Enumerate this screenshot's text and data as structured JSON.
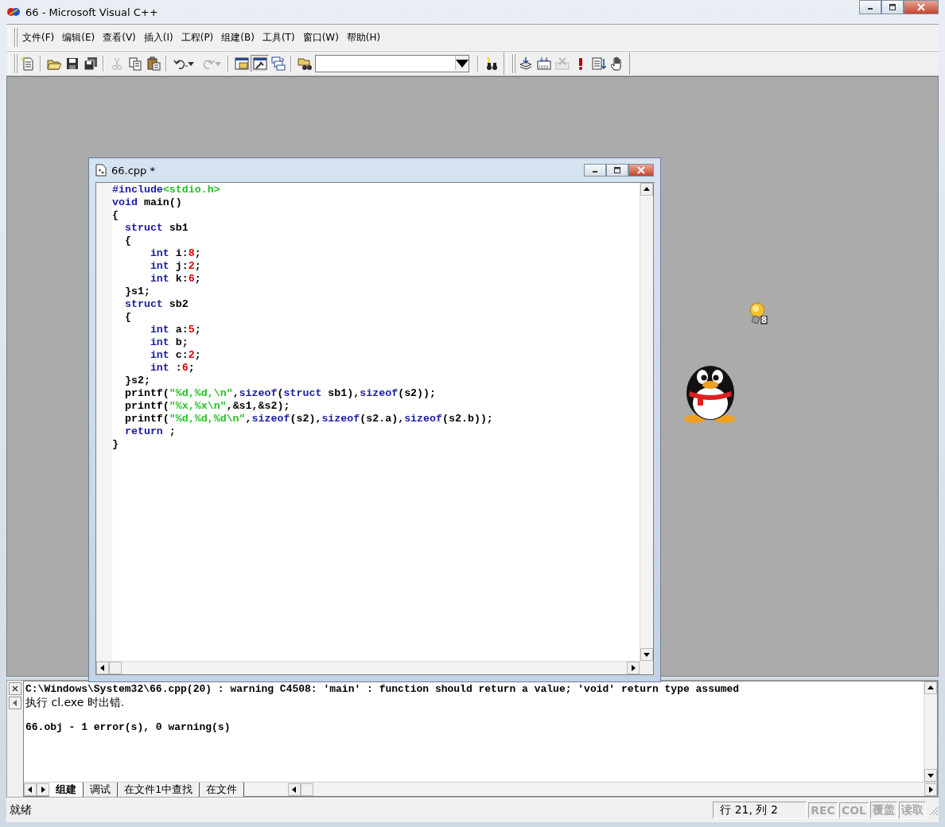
{
  "window": {
    "title": "66 - Microsoft Visual C++"
  },
  "menu": [
    "文件(F)",
    "编辑(E)",
    "查看(V)",
    "插入(I)",
    "工程(P)",
    "组建(B)",
    "工具(T)",
    "窗口(W)",
    "帮助(H)"
  ],
  "toolbars": [
    {
      "kind": "new",
      "disabled": false,
      "pressed": false
    },
    {
      "kind": "sep"
    },
    {
      "kind": "open",
      "disabled": false,
      "pressed": false
    },
    {
      "kind": "save",
      "disabled": false,
      "pressed": false
    },
    {
      "kind": "saveall",
      "disabled": false,
      "pressed": false
    },
    {
      "kind": "sep"
    },
    {
      "kind": "cut",
      "disabled": true,
      "pressed": false
    },
    {
      "kind": "copy",
      "disabled": false,
      "pressed": false
    },
    {
      "kind": "paste",
      "disabled": false,
      "pressed": false
    },
    {
      "kind": "sep"
    },
    {
      "kind": "undo",
      "disabled": false,
      "pressed": false
    },
    {
      "kind": "redo",
      "disabled": true,
      "pressed": false
    },
    {
      "kind": "sep"
    },
    {
      "kind": "workspace",
      "disabled": false,
      "pressed": false
    },
    {
      "kind": "output",
      "disabled": false,
      "pressed": true
    },
    {
      "kind": "windows",
      "disabled": false,
      "pressed": false
    },
    {
      "kind": "sep"
    },
    {
      "kind": "findfiles",
      "disabled": false,
      "pressed": false
    },
    {
      "kind": "combo"
    },
    {
      "kind": "sep"
    },
    {
      "kind": "search",
      "disabled": false,
      "pressed": false
    },
    {
      "kind": "grip"
    },
    {
      "kind": "compile",
      "disabled": false,
      "pressed": false
    },
    {
      "kind": "build",
      "disabled": false,
      "pressed": false
    },
    {
      "kind": "stop",
      "disabled": true,
      "pressed": false
    },
    {
      "kind": "execute",
      "disabled": false,
      "pressed": false
    },
    {
      "kind": "go",
      "disabled": false,
      "pressed": false
    },
    {
      "kind": "breakpoint",
      "disabled": false,
      "pressed": false
    }
  ],
  "editor": {
    "title": "66.cpp *",
    "lines": [
      [
        {
          "kind": "pre",
          "text": "#include"
        },
        {
          "kind": "str",
          "text": "<stdio.h>"
        }
      ],
      [
        {
          "kind": "kw",
          "text": "void"
        },
        {
          "kind": "txt",
          "text": " main()"
        }
      ],
      [
        {
          "kind": "txt",
          "text": "{"
        }
      ],
      [
        {
          "kind": "kw",
          "text": "  struct"
        },
        {
          "kind": "txt",
          "text": " sb1"
        }
      ],
      [
        {
          "kind": "txt",
          "text": "  {"
        }
      ],
      [
        {
          "kind": "kw",
          "text": "      int"
        },
        {
          "kind": "txt",
          "text": " i:"
        },
        {
          "kind": "num",
          "text": "8"
        },
        {
          "kind": "txt",
          "text": ";"
        }
      ],
      [
        {
          "kind": "kw",
          "text": "      int"
        },
        {
          "kind": "txt",
          "text": " j:"
        },
        {
          "kind": "num",
          "text": "2"
        },
        {
          "kind": "txt",
          "text": ";"
        }
      ],
      [
        {
          "kind": "kw",
          "text": "      int"
        },
        {
          "kind": "txt",
          "text": " k:"
        },
        {
          "kind": "num",
          "text": "6"
        },
        {
          "kind": "txt",
          "text": ";"
        }
      ],
      [
        {
          "kind": "txt",
          "text": "  }s1;"
        }
      ],
      [
        {
          "kind": "kw",
          "text": "  struct"
        },
        {
          "kind": "txt",
          "text": " sb2"
        }
      ],
      [
        {
          "kind": "txt",
          "text": "  {"
        }
      ],
      [
        {
          "kind": "kw",
          "text": "      int"
        },
        {
          "kind": "txt",
          "text": " a:"
        },
        {
          "kind": "num",
          "text": "5"
        },
        {
          "kind": "txt",
          "text": ";"
        }
      ],
      [
        {
          "kind": "kw",
          "text": "      int"
        },
        {
          "kind": "txt",
          "text": " b;"
        }
      ],
      [
        {
          "kind": "kw",
          "text": "      int"
        },
        {
          "kind": "txt",
          "text": " c:"
        },
        {
          "kind": "num",
          "text": "2"
        },
        {
          "kind": "txt",
          "text": ";"
        }
      ],
      [
        {
          "kind": "kw",
          "text": "      int"
        },
        {
          "kind": "txt",
          "text": " :"
        },
        {
          "kind": "num",
          "text": "6"
        },
        {
          "kind": "txt",
          "text": ";"
        }
      ],
      [
        {
          "kind": "txt",
          "text": "  }s2;"
        }
      ],
      [
        {
          "kind": "txt",
          "text": "  printf("
        },
        {
          "kind": "str",
          "text": "\"%d,%d,\\n\""
        },
        {
          "kind": "txt",
          "text": ","
        },
        {
          "kind": "kw",
          "text": "sizeof"
        },
        {
          "kind": "txt",
          "text": "("
        },
        {
          "kind": "kw",
          "text": "struct"
        },
        {
          "kind": "txt",
          "text": " sb1),"
        },
        {
          "kind": "kw",
          "text": "sizeof"
        },
        {
          "kind": "txt",
          "text": "(s2));"
        }
      ],
      [
        {
          "kind": "txt",
          "text": "  printf("
        },
        {
          "kind": "str",
          "text": "\"%x,%x\\n\""
        },
        {
          "kind": "txt",
          "text": ",&s1,&s2);"
        }
      ],
      [
        {
          "kind": "txt",
          "text": "  printf("
        },
        {
          "kind": "str",
          "text": "\"%d,%d,%d\\n\""
        },
        {
          "kind": "txt",
          "text": ","
        },
        {
          "kind": "kw",
          "text": "sizeof"
        },
        {
          "kind": "txt",
          "text": "(s2),"
        },
        {
          "kind": "kw",
          "text": "sizeof"
        },
        {
          "kind": "txt",
          "text": "(s2.a),"
        },
        {
          "kind": "kw",
          "text": "sizeof"
        },
        {
          "kind": "txt",
          "text": "(s2.b));"
        }
      ],
      [
        {
          "kind": "kw",
          "text": "  return"
        },
        {
          "kind": "txt",
          "text": " ;"
        }
      ],
      [
        {
          "kind": "txt",
          "text": "}"
        }
      ]
    ]
  },
  "tray": {
    "bulb_badge": "8"
  },
  "output": {
    "blocks": [
      [
        "C:\\Windows\\System32\\66.cpp(20) : warning C4508: 'main' : function should return a value; 'void' return type assumed",
        "执行 cl.exe 时出错."
      ],
      [
        "66.obj - 1 error(s), 0 warning(s)"
      ]
    ],
    "tabs": [
      {
        "label": "组建",
        "selected": true
      },
      {
        "label": "调试",
        "selected": false
      },
      {
        "label": "在文件1中查找",
        "selected": false
      },
      {
        "label": "在文件",
        "selected": false
      }
    ]
  },
  "status_bar": {
    "message": "就绪",
    "position": "行 21, 列 2",
    "indicators": [
      {
        "label": "REC",
        "disabled": true
      },
      {
        "label": "COL",
        "disabled": true
      },
      {
        "label": "覆盖",
        "disabled": true
      },
      {
        "label": "读取",
        "disabled": true
      }
    ]
  }
}
